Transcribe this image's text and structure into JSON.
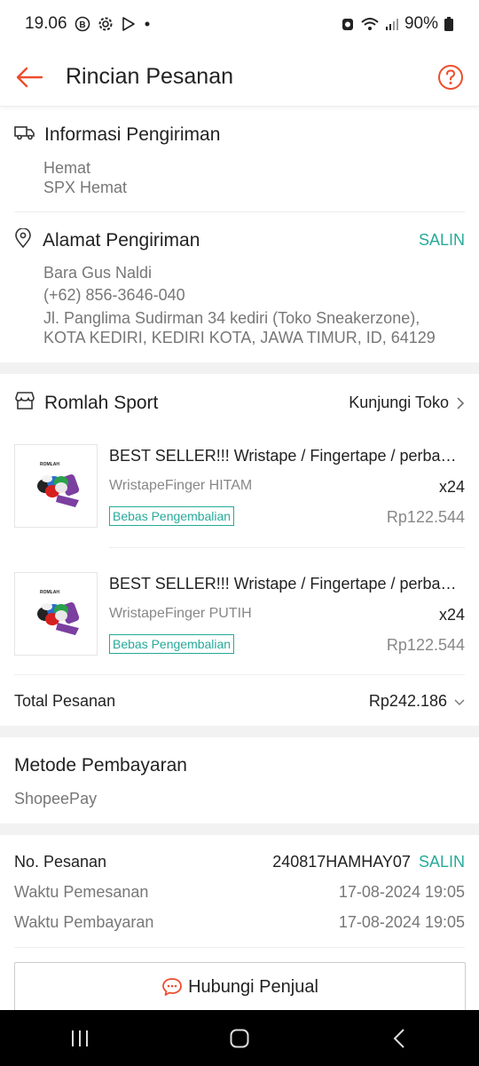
{
  "status_bar": {
    "time": "19.06",
    "battery": "90%"
  },
  "header": {
    "title": "Rincian Pesanan"
  },
  "shipping_info": {
    "title": "Informasi Pengiriman",
    "option": "Hemat",
    "courier": "SPX Hemat"
  },
  "address": {
    "title": "Alamat Pengiriman",
    "copy_label": "SALIN",
    "name": "Bara Gus Naldi",
    "phone": "(+62) 856-3646-040",
    "line1": "Jl. Panglima Sudirman 34 kediri (Toko Sneakerzone),",
    "line2": "KOTA KEDIRI, KEDIRI KOTA, JAWA TIMUR, ID, 64129"
  },
  "shop": {
    "name": "Romlah Sport",
    "visit_label": "Kunjungi Toko"
  },
  "products": [
    {
      "name": "BEST SELLER!!! Wristape / Fingertape / perban jari",
      "variant": "WristapeFinger HITAM",
      "qty": "x24",
      "badge": "Bebas Pengembalian",
      "price": "Rp122.544",
      "thumb_text": "ROMLAH"
    },
    {
      "name": "BEST SELLER!!! Wristape / Fingertape / perban jari",
      "variant": "WristapeFinger PUTIH",
      "qty": "x24",
      "badge": "Bebas Pengembalian",
      "price": "Rp122.544",
      "thumb_text": "ROMLAH"
    }
  ],
  "total": {
    "label": "Total Pesanan",
    "value": "Rp242.186"
  },
  "payment": {
    "title": "Metode Pembayaran",
    "method": "ShopeePay"
  },
  "order": {
    "number_label": "No. Pesanan",
    "number_value": "240817HAMHAY07",
    "copy_label": "SALIN",
    "order_time_label": "Waktu Pemesanan",
    "order_time_value": "17-08-2024 19:05",
    "pay_time_label": "Waktu Pembayaran",
    "pay_time_value": "17-08-2024 19:05"
  },
  "contact": {
    "label": "Hubungi Penjual"
  },
  "colors": {
    "accent": "#ee4d2d",
    "teal": "#26aa99"
  }
}
